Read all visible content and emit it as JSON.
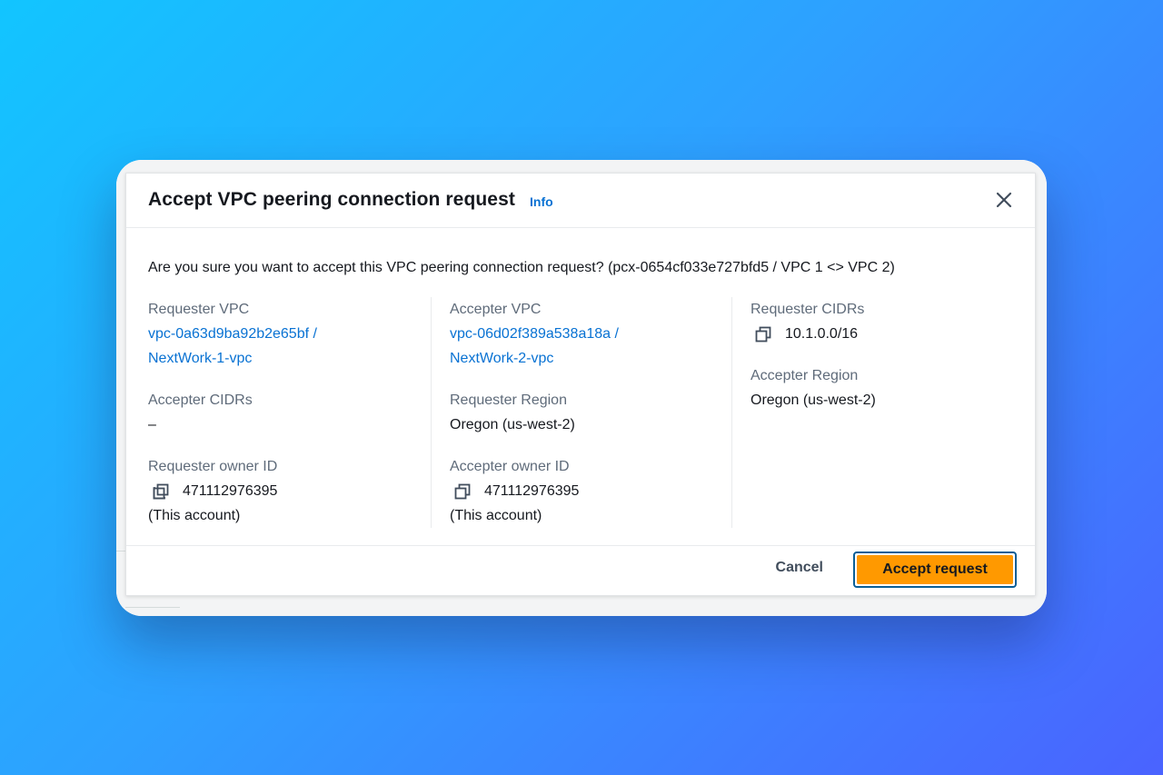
{
  "modal": {
    "title": "Accept VPC peering connection request",
    "info_label": "Info",
    "question": "Are you sure you want to accept this VPC peering connection request? (pcx-0654cf033e727bfd5 / VPC 1 <> VPC 2)"
  },
  "details": {
    "requester_vpc": {
      "label": "Requester VPC",
      "id": "vpc-0a63d9ba92b2e65bf /",
      "name": "NextWork-1-vpc"
    },
    "accepter_vpc": {
      "label": "Accepter VPC",
      "id": "vpc-06d02f389a538a18a /",
      "name": "NextWork-2-vpc"
    },
    "requester_cidrs": {
      "label": "Requester CIDRs",
      "value": "10.1.0.0/16"
    },
    "accepter_cidrs": {
      "label": "Accepter CIDRs",
      "value": "–"
    },
    "requester_region": {
      "label": "Requester Region",
      "value": "Oregon (us-west-2)"
    },
    "accepter_region": {
      "label": "Accepter Region",
      "value": "Oregon (us-west-2)"
    },
    "requester_owner": {
      "label": "Requester owner ID",
      "id": "471112976395",
      "note": "(This account)"
    },
    "accepter_owner": {
      "label": "Accepter owner ID",
      "id": "471112976395",
      "note": "(This account)"
    }
  },
  "footer": {
    "cancel_label": "Cancel",
    "accept_label": "Accept request"
  },
  "icons": {
    "close": "close-icon",
    "copy": "copy-icon"
  },
  "colors": {
    "link": "#0972d3",
    "primary_button": "#ff9900",
    "focus_ring": "#0b5e96"
  }
}
